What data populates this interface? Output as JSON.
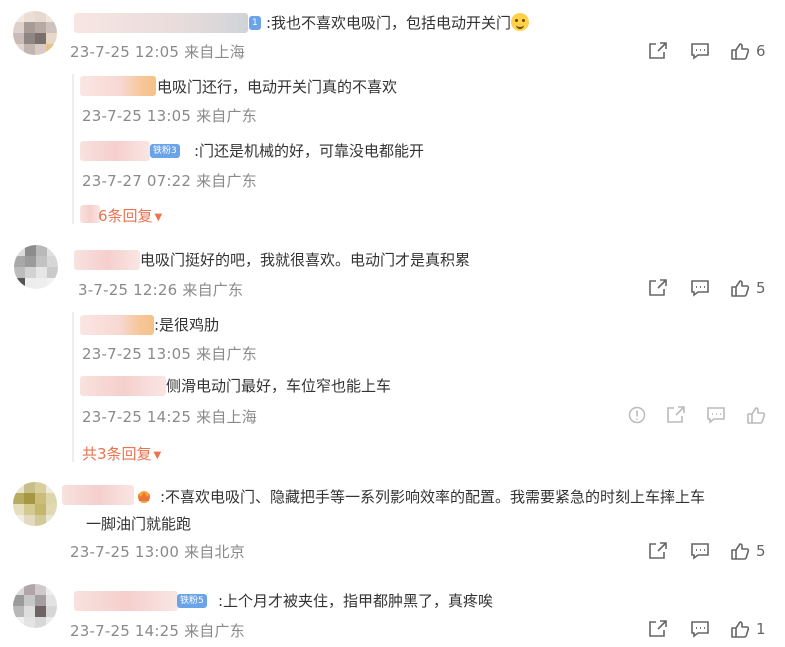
{
  "comments": [
    {
      "text": ":我也不喜欢电吸门，包括电动开关门",
      "meta": "23-7-25 12:05 来自上海",
      "badge": "1",
      "likes": "6",
      "replies": [
        {
          "text": "电吸门还行，电动开关门真的不喜欢",
          "meta": "23-7-25 13:05 来自广东"
        },
        {
          "text": ":门还是机械的好，可靠没电都能开",
          "meta": "23-7-27 07:22 来自广东",
          "badge": "铁粉3"
        }
      ],
      "more": "6条回复"
    },
    {
      "text": "电吸门挺好的吧，我就很喜欢。电动门才是真积累",
      "meta": "3-7-25 12:26 来自广东",
      "likes": "5",
      "replies": [
        {
          "text": ":是很鸡肋",
          "meta": "23-7-25 13:05 来自广东"
        },
        {
          "text": "侧滑电动门最好，车位窄也能上车",
          "meta": "23-7-25 14:25 来自上海"
        }
      ],
      "more": "共3条回复"
    },
    {
      "text": ":不喜欢电吸门、隐藏把手等一系列影响效率的配置。我需要紧急的时刻上车摔上车",
      "text2": "一脚油门就能跑",
      "meta": "23-7-25 13:00 来自北京",
      "likes": "5"
    },
    {
      "text": ":上个月才被夹住，指甲都肿黑了，真疼唉",
      "meta": "23-7-25 14:25 来自广东",
      "badge": "铁粉5",
      "likes": "1"
    }
  ],
  "icons": {
    "share": "share-icon",
    "comment": "comment-icon",
    "like": "like-icon",
    "report": "report-icon"
  },
  "colors": {
    "accent": "#eb7350",
    "meta": "#8a8a8a",
    "badge": "#6ba3e8"
  }
}
